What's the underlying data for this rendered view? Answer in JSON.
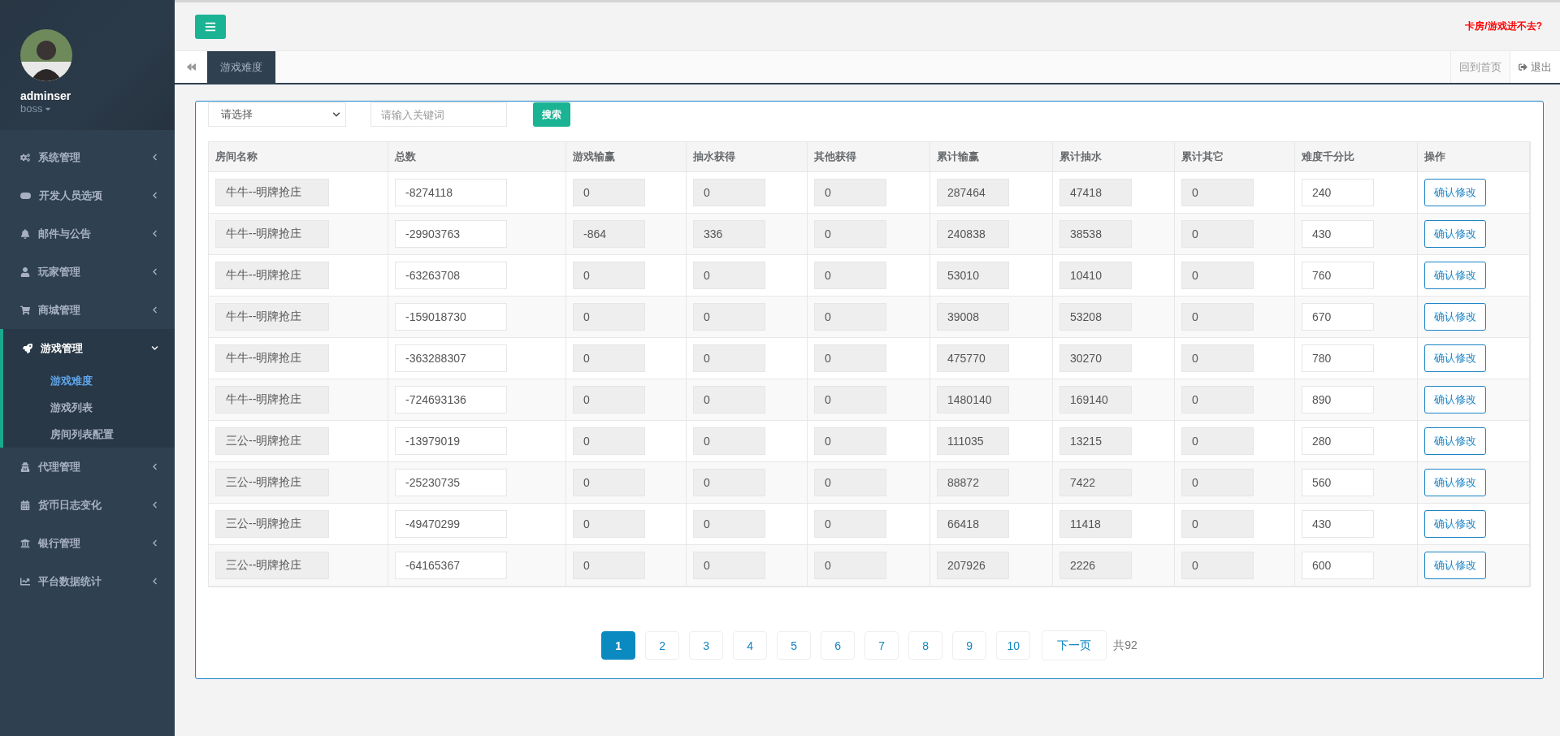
{
  "user": {
    "name": "adminser",
    "role": "boss"
  },
  "sidebar": {
    "items": [
      {
        "label": "系统管理",
        "expanded": false
      },
      {
        "label": "开发人员选项",
        "expanded": false
      },
      {
        "label": "邮件与公告",
        "expanded": false
      },
      {
        "label": "玩家管理",
        "expanded": false
      },
      {
        "label": "商城管理",
        "expanded": false
      },
      {
        "label": "游戏管理",
        "expanded": true,
        "children": [
          {
            "label": "游戏难度",
            "selected": true
          },
          {
            "label": "游戏列表",
            "selected": false
          },
          {
            "label": "房间列表配置",
            "selected": false
          }
        ]
      },
      {
        "label": "代理管理",
        "expanded": false
      },
      {
        "label": "货币日志变化",
        "expanded": false
      },
      {
        "label": "银行管理",
        "expanded": false
      },
      {
        "label": "平台数据统计",
        "expanded": false
      }
    ]
  },
  "topbar": {
    "notice": "卡房/游戏进不去?"
  },
  "tabs": [
    {
      "label": "游戏难度",
      "selected": true
    }
  ],
  "tab_actions": {
    "home": "回到首页",
    "logout": "退出"
  },
  "filter": {
    "select": "请选择",
    "search_placeholder": "请输入关键词",
    "search_button": "搜索"
  },
  "table": {
    "columns": [
      "房间名称",
      "总数",
      "游戏输赢",
      "抽水获得",
      "其他获得",
      "累计输赢",
      "累计抽水",
      "累计其它",
      "难度千分比",
      "操作"
    ],
    "rows": [
      {
        "cells": [
          "牛牛--明牌抢庄",
          "-8274118",
          "0",
          "0",
          "0",
          "287464",
          "47418",
          "0",
          "240"
        ],
        "action": "确认修改"
      },
      {
        "cells": [
          "牛牛--明牌抢庄",
          "-29903763",
          "-864",
          "336",
          "0",
          "240838",
          "38538",
          "0",
          "430"
        ],
        "action": "确认修改"
      },
      {
        "cells": [
          "牛牛--明牌抢庄",
          "-63263708",
          "0",
          "0",
          "0",
          "53010",
          "10410",
          "0",
          "760"
        ],
        "action": "确认修改"
      },
      {
        "cells": [
          "牛牛--明牌抢庄",
          "-159018730",
          "0",
          "0",
          "0",
          "39008",
          "53208",
          "0",
          "670"
        ],
        "action": "确认修改"
      },
      {
        "cells": [
          "牛牛--明牌抢庄",
          "-363288307",
          "0",
          "0",
          "0",
          "475770",
          "30270",
          "0",
          "780"
        ],
        "action": "确认修改"
      },
      {
        "cells": [
          "牛牛--明牌抢庄",
          "-724693136",
          "0",
          "0",
          "0",
          "1480140",
          "169140",
          "0",
          "890"
        ],
        "action": "确认修改"
      },
      {
        "cells": [
          "三公--明牌抢庄",
          "-13979019",
          "0",
          "0",
          "0",
          "111035",
          "13215",
          "0",
          "280"
        ],
        "action": "确认修改"
      },
      {
        "cells": [
          "三公--明牌抢庄",
          "-25230735",
          "0",
          "0",
          "0",
          "88872",
          "7422",
          "0",
          "560"
        ],
        "action": "确认修改"
      },
      {
        "cells": [
          "三公--明牌抢庄",
          "-49470299",
          "0",
          "0",
          "0",
          "66418",
          "11418",
          "0",
          "430"
        ],
        "action": "确认修改"
      },
      {
        "cells": [
          "三公--明牌抢庄",
          "-64165367",
          "0",
          "0",
          "0",
          "207926",
          "2226",
          "0",
          "600"
        ],
        "action": "确认修改"
      }
    ]
  },
  "pagination": {
    "pages": [
      {
        "label": "1",
        "selected": true
      },
      {
        "label": "2",
        "selected": false
      },
      {
        "label": "3",
        "selected": false
      },
      {
        "label": "4",
        "selected": false
      },
      {
        "label": "5",
        "selected": false
      },
      {
        "label": "6",
        "selected": false
      },
      {
        "label": "7",
        "selected": false
      },
      {
        "label": "8",
        "selected": false
      },
      {
        "label": "9",
        "selected": false
      },
      {
        "label": "10",
        "selected": false
      }
    ],
    "next": "下一页",
    "total": "共92"
  }
}
